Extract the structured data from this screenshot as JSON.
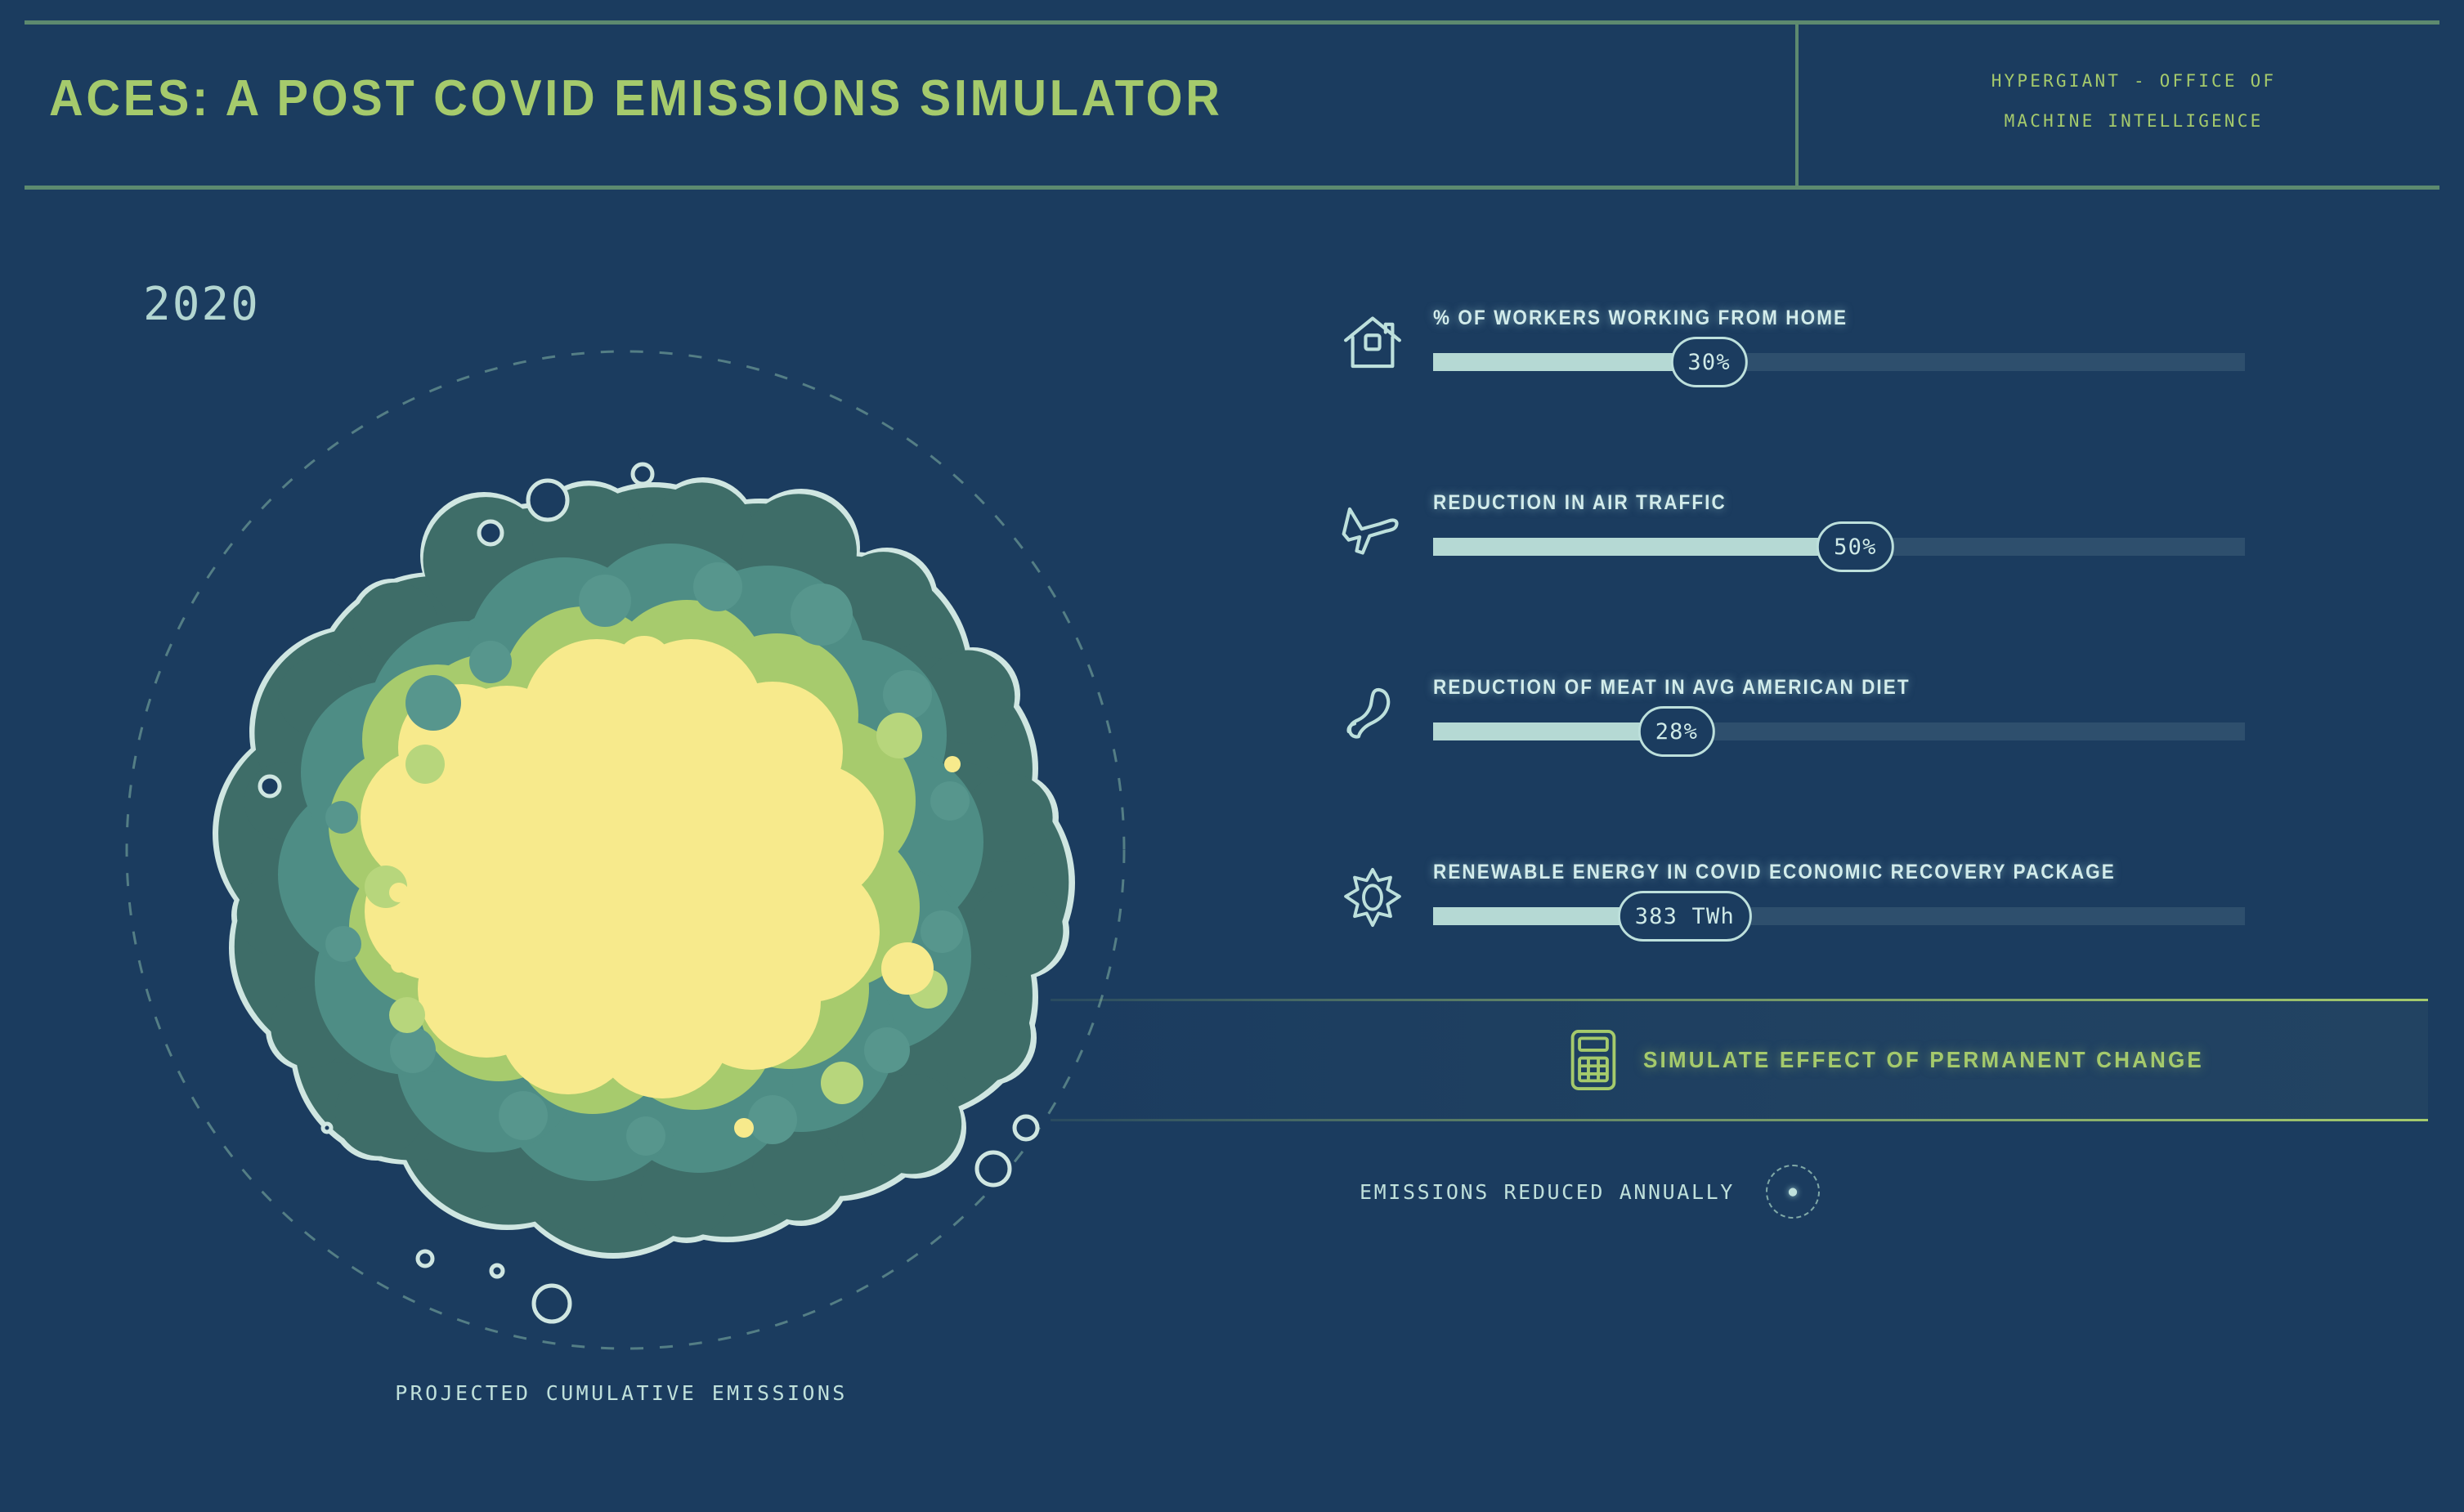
{
  "header": {
    "title": "ACES: A POST COVID EMISSIONS SIMULATOR",
    "org_line1": "HYPERGIANT - OFFICE OF",
    "org_line2": "MACHINE INTELLIGENCE",
    "accent": "#a5ca6c",
    "rule_color": "#5d8a6f"
  },
  "visualization": {
    "year": "2020",
    "caption": "PROJECTED CUMULATIVE EMISSIONS",
    "colors": {
      "background": "#1b3c5f",
      "outline": "#cfe6e1",
      "shell_dark": "#3e6d68",
      "shell_mid": "#4e8d85",
      "shell_green": "#a7cb6d",
      "core_yellow": "#f7ea8c",
      "orbit_ring": "#5e8a8c"
    }
  },
  "controls": [
    {
      "icon": "home-icon",
      "label": "% OF WORKERS WORKING FROM HOME",
      "value_text": "30%",
      "percent": 34
    },
    {
      "icon": "airplane-icon",
      "label": "REDUCTION IN AIR TRAFFIC",
      "value_text": "50%",
      "percent": 52
    },
    {
      "icon": "meat-icon",
      "label": "REDUCTION OF MEAT IN AVG AMERICAN DIET",
      "value_text": "28%",
      "percent": 30
    },
    {
      "icon": "sun-gear-icon",
      "label": "RENEWABLE ENERGY IN COVID ECONOMIC RECOVERY PACKAGE",
      "value_text": "383 TWh",
      "percent": 31
    }
  ],
  "simulate": {
    "icon": "calculator-icon",
    "label": "SIMULATE EFFECT OF PERMANENT CHANGE"
  },
  "readout": {
    "label": "EMISSIONS REDUCED ANNUALLY",
    "value": "●"
  }
}
